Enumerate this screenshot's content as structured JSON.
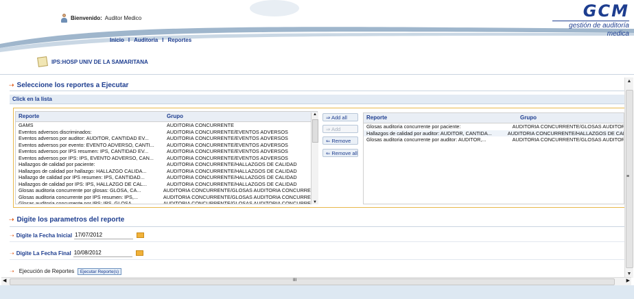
{
  "header": {
    "welcome_label": "Bienvenido:",
    "user_name": "Auditor Medico",
    "logo_brand": "GCM",
    "logo_tagline": "gestión de auditoría medica"
  },
  "nav": {
    "items": [
      "Inicio",
      "Auditoria",
      "Reportes"
    ],
    "separator": "I"
  },
  "ips": "IPS:HOSP UNIV DE LA SAMARITANA",
  "section1_title": "Seleccione los reportes a Ejecutar",
  "subbar_label": "Click en la lista",
  "available_list": {
    "headers": [
      "Reporte",
      "Grupo"
    ],
    "rows": [
      [
        "GAMS",
        "AUDITORIA CONCURRENTE"
      ],
      [
        "Eventos adversos discriminados:",
        "AUDITORIA CONCURRENTE/EVENTOS ADVERSOS"
      ],
      [
        "Eventos adversos por auditor: AUDITOR, CANTIDAD EV...",
        "AUDITORIA CONCURRENTE/EVENTOS ADVERSOS"
      ],
      [
        "Eventos adversos por evento: EVENTO ADVERSO, CANTI...",
        "AUDITORIA CONCURRENTE/EVENTOS ADVERSOS"
      ],
      [
        "Eventos adversos por IPS resumen: IPS, CANTIDAD EV...",
        "AUDITORIA CONCURRENTE/EVENTOS ADVERSOS"
      ],
      [
        "Eventos adversos por IPS: IPS, EVENTO ADVERSO, CAN...",
        "AUDITORIA CONCURRENTE/EVENTOS ADVERSOS"
      ],
      [
        "Hallazgos de calidad por paciente:",
        "AUDITORIA CONCURRENTE/HALLAZGOS DE CALIDAD"
      ],
      [
        "Hallazgos de calidad por hallazgo: HALLAZGO CALIDA...",
        "AUDITORIA CONCURRENTE/HALLAZGOS DE CALIDAD"
      ],
      [
        "Hallazgo de calidad por IPS resumen: IPS, CANTIDAD...",
        "AUDITORIA CONCURRENTE/HALLAZGOS DE CALIDAD"
      ],
      [
        "Hallazgos de calidad por IPS: IPS, HALLAZGO DE CAL...",
        "AUDITORIA CONCURRENTE/HALLAZGOS DE CALIDAD"
      ],
      [
        "Glosas auditoria concurrente por glosas: GLOSA, CA...",
        "AUDITORIA CONCURRENTE/GLOSAS AUDITORIA CONCURRENTE"
      ],
      [
        "Glosas auditoria concurrente por IPS resumen: IPS,...",
        "AUDITORIA CONCURRENTE/GLOSAS AUDITORIA CONCURRENTE"
      ],
      [
        "Glosas auditoria concurrente por IPS: IPS, GLOSA...",
        "AUDITORIA CONCURRENTE/GLOSAS AUDITORIA CONCURRENTE"
      ]
    ]
  },
  "selected_list": {
    "headers": [
      "Reporte",
      "Grupo"
    ],
    "rows": [
      [
        "Glosas auditoria concurrente por paciente:",
        "AUDITORIA CONCURRENTE/GLOSAS AUDITORIA"
      ],
      [
        "Hallazgos de calidad por auditor: AUDITOR, CANTIDA...",
        "AUDITORIA CONCURRENTE/HALLAZGOS DE CALIDA"
      ],
      [
        "Glosas auditoria concurrente por auditor: AUDITOR,...",
        "AUDITORIA CONCURRENTE/GLOSAS AUDITORIA"
      ]
    ]
  },
  "buttons": {
    "add_all": "⇒ Add all",
    "add": "⇒ Add",
    "remove": "⇐ Remove",
    "remove_all": "⇐ Remove all"
  },
  "section2_title": "Digite los parametros del reporte",
  "params": {
    "start_label": "Digite la Fecha Inicial",
    "start_value": "17/07/2012",
    "end_label": "Digite La Fecha Final",
    "end_value": "10/08/2012"
  },
  "exec": {
    "label": "Ejecución de Reportes",
    "button": "Ejecutar Reporte(s)"
  },
  "scroll": {
    "h_mid": "III",
    "v_mid": "≡"
  },
  "colors": {
    "primary": "#1d3d8f",
    "accent_arrow": "#e06020",
    "frame": "#e8b84a"
  }
}
